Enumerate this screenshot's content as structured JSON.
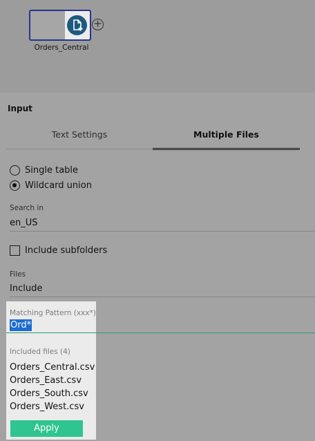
{
  "flow": {
    "node_label": "Orders_Central",
    "node_icon": "file-add-icon",
    "add_step_glyph": "+"
  },
  "panel": {
    "title": "Input",
    "tabs": [
      {
        "label": "Text Settings",
        "active": false
      },
      {
        "label": "Multiple Files",
        "active": true
      }
    ],
    "union_options": [
      {
        "label": "Single table",
        "selected": false
      },
      {
        "label": "Wildcard union",
        "selected": true
      }
    ],
    "search_in": {
      "label": "Search in",
      "value": "en_US"
    },
    "include_subfolders": {
      "label": "Include subfolders",
      "checked": false
    },
    "files": {
      "label": "Files",
      "value": "Include"
    }
  },
  "popup": {
    "matching_label": "Matching Pattern (xxx*)",
    "matching_value": "Ord*",
    "included_label": "Included files (4)",
    "included_files": [
      "Orders_Central.csv",
      "Orders_East.csv",
      "Orders_South.csv",
      "Orders_West.csv"
    ],
    "apply_label": "Apply"
  },
  "colors": {
    "node_border": "#26358e",
    "icon_circle": "#1d5a7e",
    "focus_line": "#2e9b6a",
    "selection": "#1c6cd1",
    "apply_button": "#2fc490"
  }
}
